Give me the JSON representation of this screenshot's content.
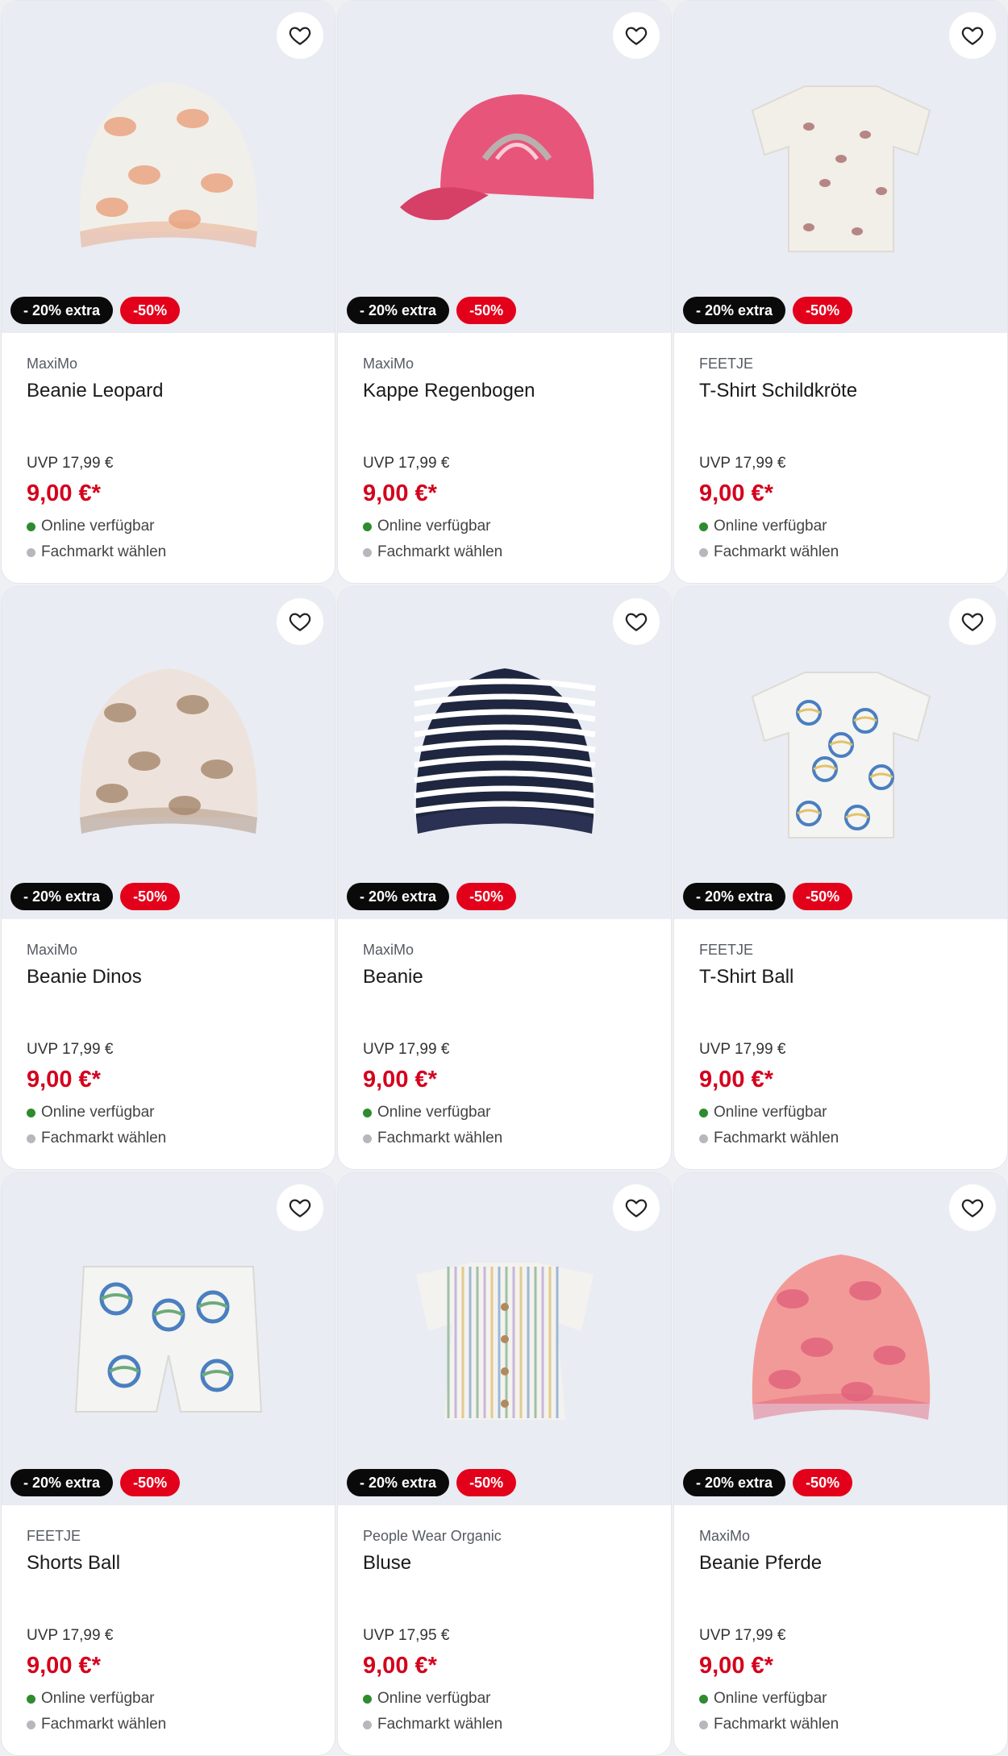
{
  "colors": {
    "sale_red": "#e3001b",
    "price_red": "#d4021d",
    "available_green": "#2e8b2e",
    "badge_black": "#0a0a0a",
    "image_bg": "#e9ecf2"
  },
  "products": [
    {
      "brand": "MaxiMo",
      "name": "Beanie Leopard",
      "uvp": "UVP 17,99 €",
      "price": "9,00 €*",
      "badge_extra": "- 20% extra",
      "badge_sale": "-50%",
      "availability": "Online verfügbar",
      "store": "Fachmarkt wählen",
      "icon": "beanie-leopard-image",
      "img_color": "#f1efea",
      "img_accent": "#e8a07a"
    },
    {
      "brand": "MaxiMo",
      "name": "Kappe Regenbogen",
      "uvp": "UVP 17,99 €",
      "price": "9,00 €*",
      "badge_extra": "- 20% extra",
      "badge_sale": "-50%",
      "availability": "Online verfügbar",
      "store": "Fachmarkt wählen",
      "icon": "cap-rainbow-image",
      "img_color": "#e8557a",
      "img_accent": "#b9b0ae"
    },
    {
      "brand": "FEETJE",
      "name": "T-Shirt Schildkröte",
      "uvp": "UVP 17,99 €",
      "price": "9,00 €*",
      "badge_extra": "- 20% extra",
      "badge_sale": "-50%",
      "availability": "Online verfügbar",
      "store": "Fachmarkt wählen",
      "icon": "tshirt-turtle-image",
      "img_color": "#f2eee8",
      "img_accent": "#a66b6b"
    },
    {
      "brand": "MaxiMo",
      "name": "Beanie Dinos",
      "uvp": "UVP 17,99 €",
      "price": "9,00 €*",
      "badge_extra": "- 20% extra",
      "badge_sale": "-50%",
      "availability": "Online verfügbar",
      "store": "Fachmarkt wählen",
      "icon": "beanie-dinos-image",
      "img_color": "#ede3dc",
      "img_accent": "#a5866c"
    },
    {
      "brand": "MaxiMo",
      "name": "Beanie",
      "uvp": "UVP 17,99 €",
      "price": "9,00 €*",
      "badge_extra": "- 20% extra",
      "badge_sale": "-50%",
      "availability": "Online verfügbar",
      "store": "Fachmarkt wählen",
      "icon": "beanie-striped-image",
      "img_color": "#1f2640",
      "img_accent": "#ffffff"
    },
    {
      "brand": "FEETJE",
      "name": "T-Shirt Ball",
      "uvp": "UVP 17,99 €",
      "price": "9,00 €*",
      "badge_extra": "- 20% extra",
      "badge_sale": "-50%",
      "availability": "Online verfügbar",
      "store": "Fachmarkt wählen",
      "icon": "tshirt-ball-image",
      "img_color": "#f4f4f2",
      "img_accent": "#4a7fc0"
    },
    {
      "brand": "FEETJE",
      "name": "Shorts Ball",
      "uvp": "UVP 17,99 €",
      "price": "9,00 €*",
      "badge_extra": "- 20% extra",
      "badge_sale": "-50%",
      "availability": "Online verfügbar",
      "store": "Fachmarkt wählen",
      "icon": "shorts-ball-image",
      "img_color": "#f4f4f2",
      "img_accent": "#4a7fc0"
    },
    {
      "brand": "People Wear Organic",
      "name": "Bluse",
      "uvp": "UVP 17,95 €",
      "price": "9,00 €*",
      "badge_extra": "- 20% extra",
      "badge_sale": "-50%",
      "availability": "Online verfügbar",
      "store": "Fachmarkt wählen",
      "icon": "blouse-striped-image",
      "img_color": "#f3f2ee",
      "img_accent": "#9fc0a8"
    },
    {
      "brand": "MaxiMo",
      "name": "Beanie Pferde",
      "uvp": "UVP 17,99 €",
      "price": "9,00 €*",
      "badge_extra": "- 20% extra",
      "badge_sale": "-50%",
      "availability": "Online verfügbar",
      "store": "Fachmarkt wählen",
      "icon": "beanie-horses-image",
      "img_color": "#f29a98",
      "img_accent": "#e0607a"
    }
  ]
}
